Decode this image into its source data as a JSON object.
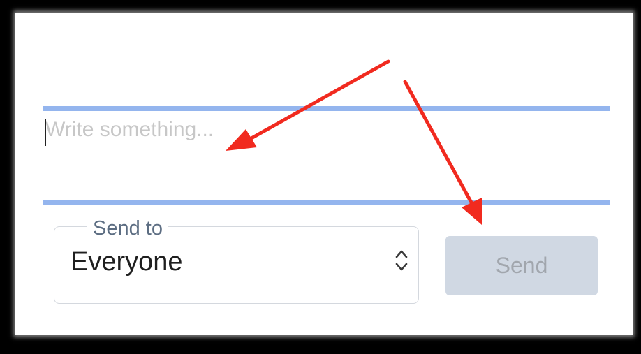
{
  "composer": {
    "placeholder": "Write something...",
    "value": ""
  },
  "recipient": {
    "label": "Send to",
    "selected": "Everyone",
    "options": [
      "Everyone"
    ]
  },
  "send_button": {
    "label": "Send",
    "enabled": false
  },
  "annotation": {
    "arrow_color": "#f12a1f",
    "focus_underline_color": "#94b5ee"
  }
}
